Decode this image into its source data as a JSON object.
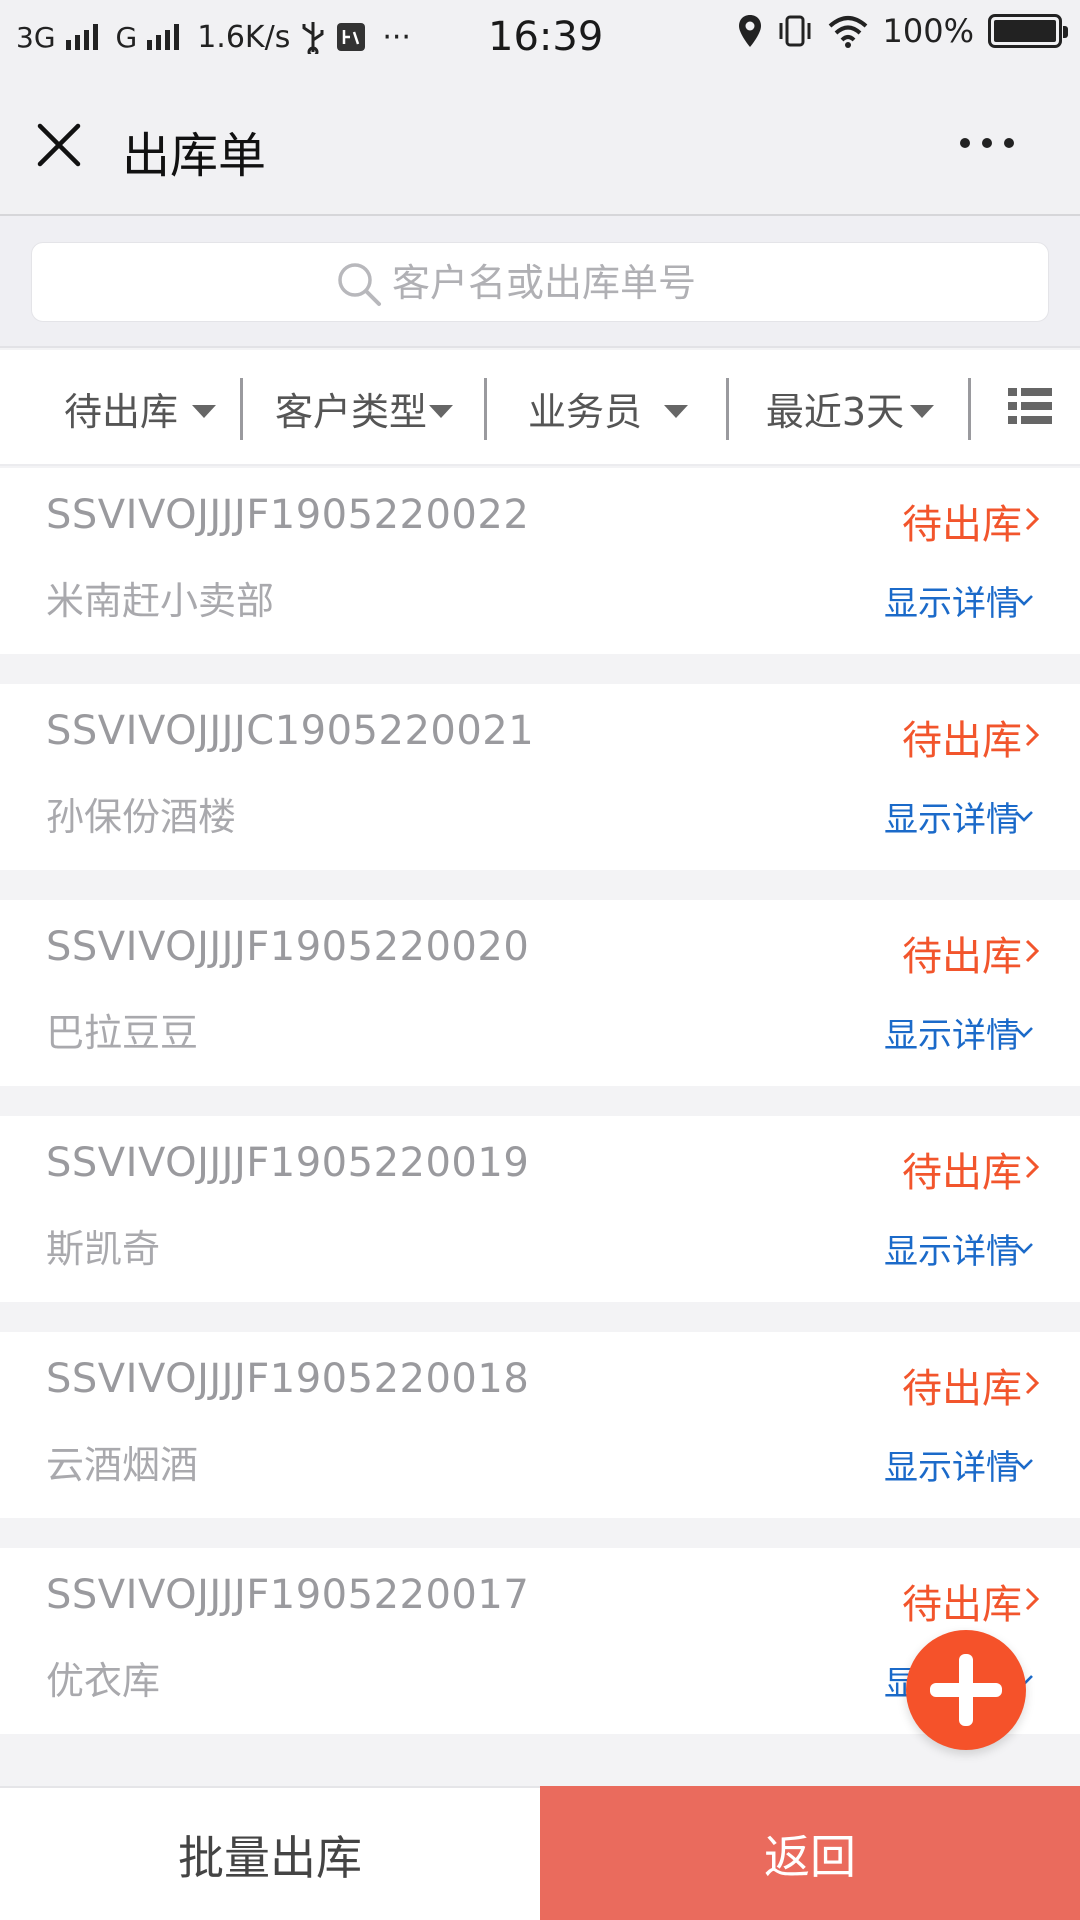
{
  "statusbar": {
    "net1": "3G",
    "net2": "G",
    "speed": "1.6K/s",
    "dots": "···",
    "time": "16:39",
    "battery": "100%"
  },
  "nav": {
    "title": "出库单",
    "close_icon": "close-icon",
    "more_icon": "more-icon"
  },
  "search": {
    "placeholder": "客户名或出库单号",
    "value": ""
  },
  "filters": [
    {
      "label": "待出库"
    },
    {
      "label": "客户类型"
    },
    {
      "label": "业务员"
    },
    {
      "label": "最近3天"
    }
  ],
  "orders": [
    {
      "order_no": "SSVIVOJJJJF1905220022",
      "customer": "米南赶小卖部",
      "status": "待出库",
      "detail": "显示详情"
    },
    {
      "order_no": "SSVIVOJJJJC1905220021",
      "customer": "孙保份酒楼",
      "status": "待出库",
      "detail": "显示详情"
    },
    {
      "order_no": "SSVIVOJJJJF1905220020",
      "customer": "巴拉豆豆",
      "status": "待出库",
      "detail": "显示详情"
    },
    {
      "order_no": "SSVIVOJJJJF1905220019",
      "customer": "斯凯奇",
      "status": "待出库",
      "detail": "显示详情"
    },
    {
      "order_no": "SSVIVOJJJJF1905220018",
      "customer": "云酒烟酒",
      "status": "待出库",
      "detail": "显示详情"
    },
    {
      "order_no": "SSVIVOJJJJF1905220017",
      "customer": "优衣库",
      "status": "待出库",
      "detail": "显示详情"
    }
  ],
  "bottom": {
    "batch_label": "批量出库",
    "back_label": "返回"
  },
  "colors": {
    "status": "#f2552c",
    "detail_link": "#1b6ac9",
    "back_button": "#ea6b5d",
    "fab": "#f5522a"
  }
}
